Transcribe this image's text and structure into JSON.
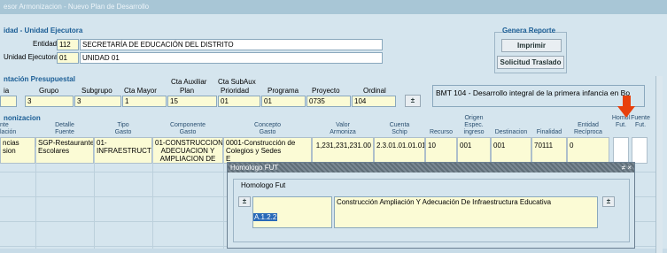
{
  "window": {
    "title": "esor Armonizacion - Nuevo Plan de Desarrollo"
  },
  "entidad": {
    "section_title": "idad - Unidad Ejecutora",
    "entidad_label": "Entidad",
    "entidad_code": "112",
    "entidad_name": "SECRETARÍA DE EDUCACIÓN DEL DISTRITO",
    "unidad_label": "Unidad Ejecutora",
    "unidad_code": "01",
    "unidad_name": "UNIDAD 01"
  },
  "report": {
    "title": "Genera Reporte",
    "print_label": "Imprimir",
    "transfer_label": "Solicitud Traslado"
  },
  "budget": {
    "section_title": "ntación Presupuestal",
    "headers": {
      "cuenta": "ia",
      "grupo": "Grupo",
      "subgrupo": "Subgrupo",
      "cta_mayor": "Cta Mayor",
      "cta_aux": "Cta Auxiliar",
      "plan": "Plan",
      "cta_subaux": "Cta SubAux",
      "prioridad": "Prioridad",
      "programa": "Programa",
      "proyecto": "Proyecto",
      "ordinal": "Ordinal"
    },
    "values": {
      "grupo": "3",
      "subgrupo": "3",
      "cta_mayor": "1",
      "plan": "15",
      "prioridad": "01",
      "programa": "01",
      "proyecto": "0735",
      "ordinal": "104"
    },
    "bmt_text": "BMT 104 - Desarrollo integral de la primera infancia en Bo",
    "expand_icon": "±"
  },
  "grid": {
    "section_title": "nonizacion",
    "headers": {
      "c1a": "nte",
      "c1b": "lación",
      "c2a": "Detalle",
      "c2b": "Fuente",
      "c3a": "Tipo",
      "c3b": "Gasto",
      "c4a": "Componente",
      "c4b": "Gasto",
      "c5a": "Concepto",
      "c5b": "Gasto",
      "c6a": "Valor",
      "c6b": "Armoniza",
      "c7a": "Cuenta",
      "c7b": "Schip",
      "c8": "Recurso",
      "c9a": "Origen",
      "c9b": "Espec.",
      "c9c": "ingreso",
      "c10": "Destinacion",
      "c11": "Finalidad",
      "c12a": "Entidad",
      "c12b": "Recíproca",
      "c13a": "Homol",
      "c13b": "Fut.",
      "c14a": "Fuente",
      "c14b": "Fut."
    },
    "row1": {
      "c1": "ncias\nsion",
      "c2": "SGP-Restaurantes\nEscolares",
      "c3": "01-\nINFRAESTRUCTURA",
      "c4": "01-CONSTRUCCION,\nADECUACION Y\nAMPLIACION DE",
      "c5": "0001-Construcción de\nColegios y Sedes\nE",
      "c6": "1,231,231,231.00",
      "c7": "2.3.01.01.01.01",
      "c8": "10",
      "c9": "001",
      "c10": "001",
      "c11": "70111",
      "c12": "0"
    }
  },
  "dialog": {
    "title": "Homologo FUT",
    "section": "Homologo Fut",
    "code": "A.1.2.2",
    "description": "Construcción Ampliación Y Adecuación De Infraestructura Educativa",
    "expand_icon": "±",
    "controls": "≠ ×"
  },
  "colors": {
    "accent_arrow": "#e8400c",
    "title_blue": "#1a5d95"
  }
}
